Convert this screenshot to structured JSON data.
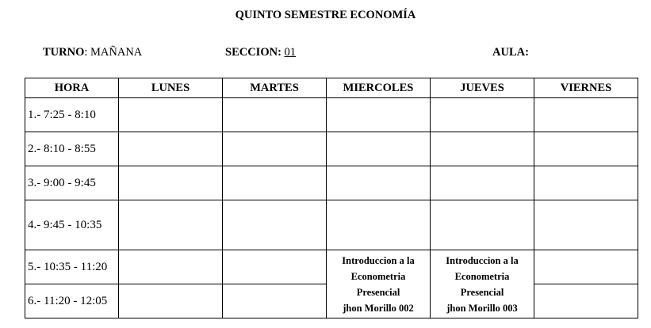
{
  "title": "QUINTO SEMESTRE ECONOMÍA",
  "turno": {
    "label": "TURNO",
    "value": ": MAÑANA"
  },
  "seccion": {
    "label": "SECCION:",
    "value": "01"
  },
  "aula": {
    "label": "AULA:"
  },
  "headers": [
    "HORA",
    "LUNES",
    "MARTES",
    "MIERCOLES",
    "JUEVES",
    "VIERNES"
  ],
  "hours": [
    "1.-  7:25 - 8:10",
    "2.-  8:10 - 8:55",
    "3.-  9:00 - 9:45",
    "4.-  9:45 - 10:35",
    "5.- 10:35 - 11:20",
    "6.- 11:20 - 12:05"
  ],
  "classes": {
    "miercoles": [
      "Introduccion a la",
      "Econometria",
      "Presencial",
      "jhon Morillo 002"
    ],
    "jueves": [
      "Introduccion  a la",
      "Econometria",
      "Presencial",
      "jhon Morillo 003"
    ]
  }
}
